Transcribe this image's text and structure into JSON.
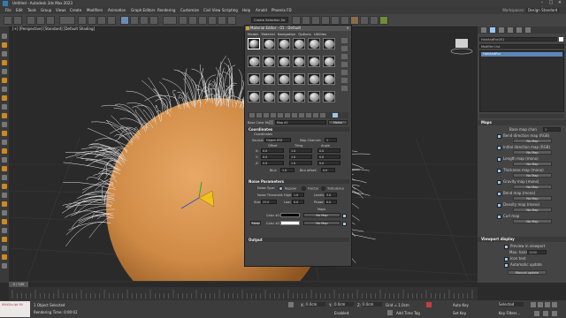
{
  "app": {
    "title": "Untitled - Autodesk 3ds Max 2023"
  },
  "window_buttons": {
    "minimize": "–",
    "maximize": "□",
    "close": "×"
  },
  "menubar": {
    "items": [
      "File",
      "Edit",
      "Tools",
      "Group",
      "Views",
      "Create",
      "Modifiers",
      "Animation",
      "Graph Editors",
      "Rendering",
      "Customize",
      "Civil View",
      "Scripting",
      "Help",
      "Arnold",
      "Phoenix FD"
    ],
    "right": [
      "Workspaces:",
      "Design Standard"
    ]
  },
  "toolbar": {
    "selection_set": "Create Selection Se"
  },
  "viewport": {
    "label": "[+] [Perspective] [Standard] [Default Shading]"
  },
  "material_editor": {
    "title": "Material Editor - 01 - Default",
    "menu": [
      "Modes",
      "Material",
      "Navigation",
      "Options",
      "Utilities"
    ],
    "slot_name": "Base Color Map",
    "map_name": "Map #1",
    "map_type": "Noise",
    "coordinates": {
      "section": "Coordinates",
      "subsection": "Coordinates",
      "source_label": "Source:",
      "source_value": "Object XYZ",
      "map_channel_label": "Map Channel:",
      "map_channel_value": "1",
      "col_offset": "Offset",
      "col_tiling": "Tiling",
      "col_angle": "Angle",
      "row_labels": [
        "X:",
        "Y:",
        "Z:"
      ],
      "offsets": [
        "0.0",
        "0.0",
        "0.0"
      ],
      "tilings": [
        "1.0",
        "1.0",
        "1.0"
      ],
      "angles": [
        "0.0",
        "0.0",
        "0.0"
      ],
      "blur_label": "Blur:",
      "blur_value": "1.0",
      "blur_offset_label": "Blur offset:",
      "blur_offset_value": "0.0"
    },
    "noise": {
      "section": "Noise Parameters",
      "type_label": "Noise Type:",
      "types": [
        "Regular",
        "Fractal",
        "Turbulence"
      ],
      "selected_type": "Regular",
      "threshold_label": "Noise Threshold:",
      "high_label": "High:",
      "high_value": "1.0",
      "levels_label": "Levels:",
      "levels_value": "3.0",
      "size_label": "Size:",
      "size_value": "25.0",
      "low_label": "Low:",
      "low_value": "0.0",
      "phase_label": "Phase:",
      "phase_value": "0.0",
      "maps_label": "Maps",
      "swap_label": "Swap",
      "color1_label": "Color #1",
      "color2_label": "Color #2",
      "no_map": "No Map",
      "color1": "#000000",
      "color2": "#ffffff"
    },
    "output": {
      "section": "Output"
    }
  },
  "right_panel": {
    "object_name": "HairAndFur001",
    "modifier_list": "Modifier List",
    "stack_item": "HairAndFur",
    "maps_section": "Maps",
    "base_map_channel": "Base map chan",
    "base_map_channel_value": "1",
    "maps": [
      {
        "label": "Bend direction map (RGB)",
        "btn": "No Map"
      },
      {
        "label": "Initial direction map (RGB)",
        "btn": "No Map"
      },
      {
        "label": "Length map (mono)",
        "btn": "No Map"
      },
      {
        "label": "Thickness map (mono)",
        "btn": "No Map"
      },
      {
        "label": "Gravity map (mono)",
        "btn": "No Map"
      },
      {
        "label": "Bend map (mono)",
        "btn": "No Map"
      },
      {
        "label": "Density map (mono)",
        "btn": "No Map"
      },
      {
        "label": "Curl map",
        "btn": "No Map"
      }
    ],
    "viewport_section": "Viewport display",
    "preview_label": "Preview in viewport",
    "max_hairs_label": "Max. hairs",
    "max_hairs_value": "1000",
    "icon_text_label": "Icon text",
    "auto_update_label": "Automatic update",
    "manual_update": "Manual update"
  },
  "timeline": {
    "frame": "0 / 100"
  },
  "status": {
    "selection": "1 Object Selected",
    "render_time": "Rendering Time: 0:00:02",
    "x_label": "X:",
    "x_value": "0.0cm",
    "y_label": "Y:",
    "y_value": "0.0cm",
    "z_label": "Z:",
    "z_value": "0.0cm",
    "grid": "Grid = 1.0cm",
    "enabled": "Enabled:",
    "add_time_tag": "Add Time Tag",
    "autokey": "Auto Key",
    "selected": "Selected",
    "set_key": "Set Key",
    "key_filters": "Key Filters...",
    "corner_label": "MAXScript Mi"
  }
}
